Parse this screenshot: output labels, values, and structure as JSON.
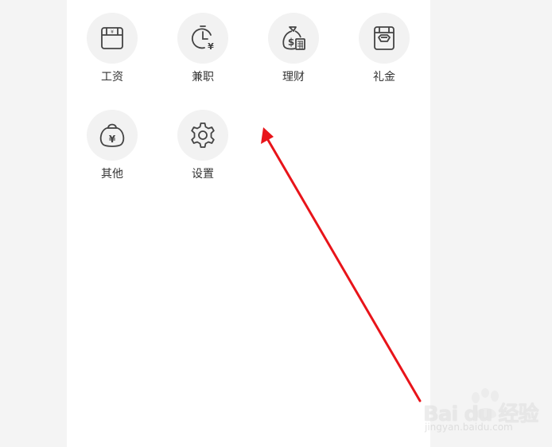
{
  "categories": [
    {
      "label": "工资",
      "icon": "wallet-icon"
    },
    {
      "label": "兼职",
      "icon": "clock-yen-icon"
    },
    {
      "label": "理财",
      "icon": "money-bag-calculator-icon"
    },
    {
      "label": "礼金",
      "icon": "gift-money-icon"
    },
    {
      "label": "其他",
      "icon": "money-pouch-icon"
    },
    {
      "label": "设置",
      "icon": "gear-icon"
    }
  ],
  "annotation": {
    "color": "#e8141a"
  },
  "watermark": {
    "logo": "Bai du 经验",
    "site": "jingyan.baidu.com"
  }
}
